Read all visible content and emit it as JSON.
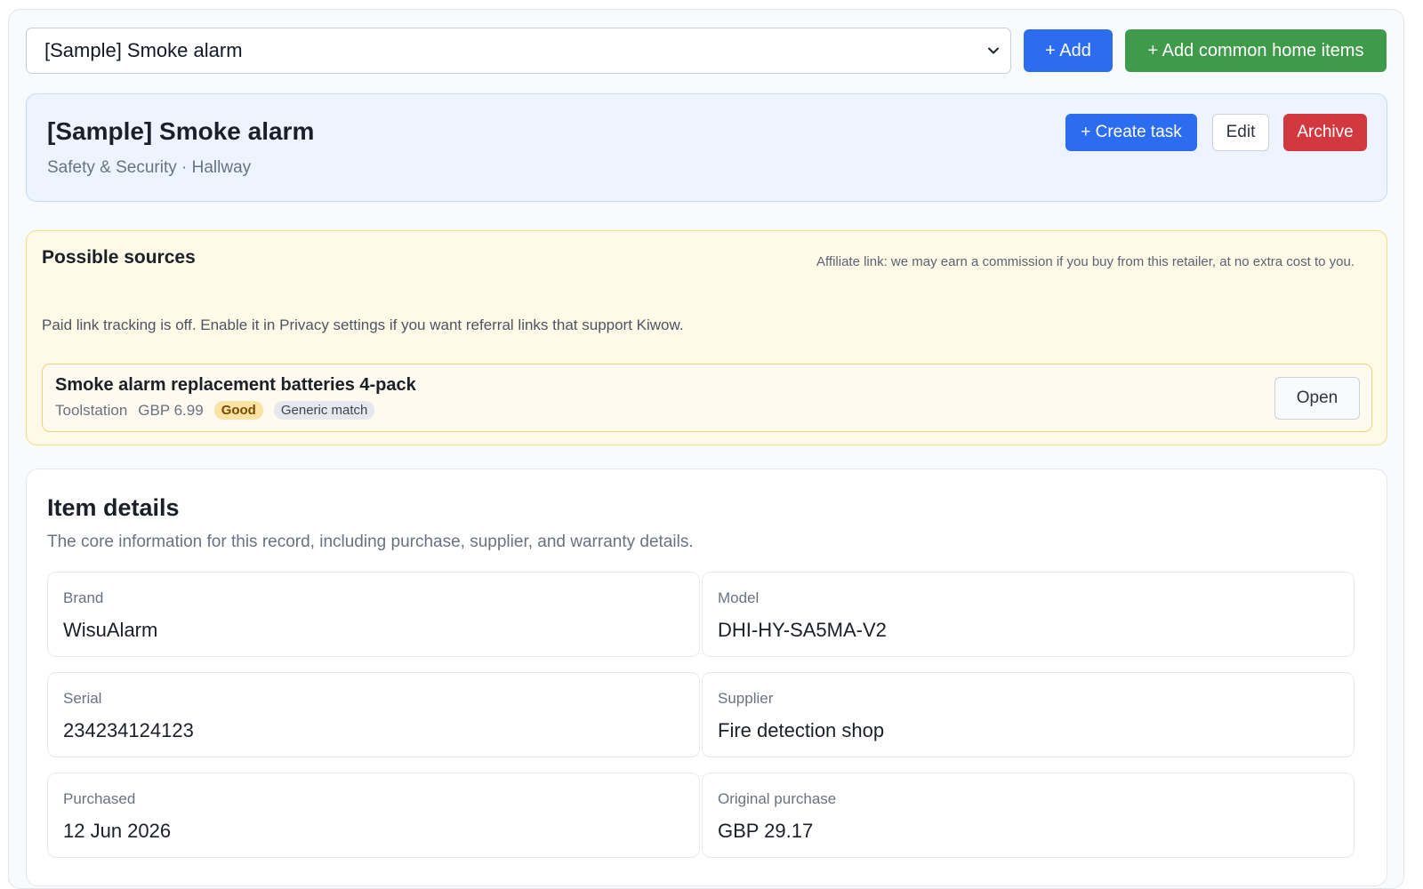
{
  "topbar": {
    "selected_item": "[Sample] Smoke alarm",
    "add_label": "+ Add",
    "add_common_label": "+ Add common home items"
  },
  "item": {
    "title": "[Sample] Smoke alarm",
    "subtitle": "Safety & Security · Hallway",
    "create_task_label": "+ Create task",
    "edit_label": "Edit",
    "archive_label": "Archive"
  },
  "sources": {
    "title": "Possible sources",
    "affiliate_note": "Affiliate link: we may earn a commission if you buy from this retailer, at no extra cost to you.",
    "tracking_note": "Paid link tracking is off. Enable it in Privacy settings if you want referral links that support Kiwow.",
    "items": [
      {
        "name": "Smoke alarm replacement batteries 4-pack",
        "retailer": "Toolstation",
        "price": "GBP 6.99",
        "quality": "Good",
        "match": "Generic match",
        "open_label": "Open"
      }
    ]
  },
  "details": {
    "title": "Item details",
    "description": "The core information for this record, including purchase, supplier, and warranty details.",
    "fields": [
      {
        "label": "Brand",
        "value": "WisuAlarm"
      },
      {
        "label": "Model",
        "value": "DHI-HY-SA5MA-V2"
      },
      {
        "label": "Serial",
        "value": "234234124123"
      },
      {
        "label": "Supplier",
        "value": "Fire detection shop"
      },
      {
        "label": "Purchased",
        "value": "12 Jun 2026"
      },
      {
        "label": "Original purchase",
        "value": "GBP 29.17"
      }
    ]
  },
  "colors": {
    "primary": "#2c6cf0",
    "success": "#3f9b4b",
    "danger": "#d2383f",
    "warning_bg": "#fff9e8"
  },
  "icons": {
    "select_arrow": "chevron-down-icon"
  }
}
